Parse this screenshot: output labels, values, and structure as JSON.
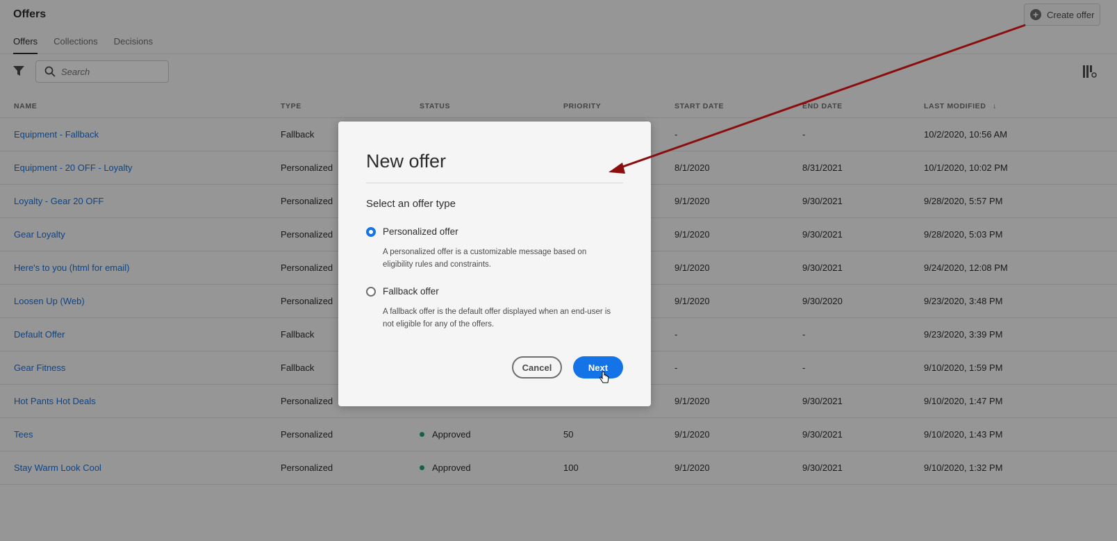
{
  "header": {
    "title": "Offers",
    "create_label": "Create offer",
    "tabs": [
      "Offers",
      "Collections",
      "Decisions"
    ]
  },
  "search": {
    "placeholder": "Search"
  },
  "table": {
    "columns": [
      "NAME",
      "TYPE",
      "STATUS",
      "PRIORITY",
      "START DATE",
      "END DATE",
      "LAST MODIFIED"
    ],
    "rows": [
      {
        "name": "Equipment - Fallback",
        "type": "Fallback",
        "status": "",
        "priority": "",
        "start": "-",
        "end": "-",
        "modified": "10/2/2020, 10:56 AM"
      },
      {
        "name": "Equipment - 20 OFF - Loyalty",
        "type": "Personalized",
        "status": "",
        "priority": "",
        "start": "8/1/2020",
        "end": "8/31/2021",
        "modified": "10/1/2020, 10:02 PM"
      },
      {
        "name": "Loyalty - Gear 20 OFF",
        "type": "Personalized",
        "status": "",
        "priority": "",
        "start": "9/1/2020",
        "end": "9/30/2021",
        "modified": "9/28/2020, 5:57 PM"
      },
      {
        "name": "Gear Loyalty",
        "type": "Personalized",
        "status": "",
        "priority": "",
        "start": "9/1/2020",
        "end": "9/30/2021",
        "modified": "9/28/2020, 5:03 PM"
      },
      {
        "name": "Here's to you (html for email)",
        "type": "Personalized",
        "status": "",
        "priority": "",
        "start": "9/1/2020",
        "end": "9/30/2021",
        "modified": "9/24/2020, 12:08 PM"
      },
      {
        "name": "Loosen Up (Web)",
        "type": "Personalized",
        "status": "",
        "priority": "",
        "start": "9/1/2020",
        "end": "9/30/2020",
        "modified": "9/23/2020, 3:48 PM"
      },
      {
        "name": "Default Offer",
        "type": "Fallback",
        "status": "",
        "priority": "",
        "start": "-",
        "end": "-",
        "modified": "9/23/2020, 3:39 PM"
      },
      {
        "name": "Gear Fitness",
        "type": "Fallback",
        "status": "",
        "priority": "",
        "start": "-",
        "end": "-",
        "modified": "9/10/2020, 1:59 PM"
      },
      {
        "name": "Hot Pants Hot Deals",
        "type": "Personalized",
        "status": "",
        "priority": "",
        "start": "9/1/2020",
        "end": "9/30/2021",
        "modified": "9/10/2020, 1:47 PM"
      },
      {
        "name": "Tees",
        "type": "Personalized",
        "status": "Approved",
        "priority": "50",
        "start": "9/1/2020",
        "end": "9/30/2021",
        "modified": "9/10/2020, 1:43 PM"
      },
      {
        "name": "Stay Warm Look Cool",
        "type": "Personalized",
        "status": "Approved",
        "priority": "100",
        "start": "9/1/2020",
        "end": "9/30/2021",
        "modified": "9/10/2020, 1:32 PM"
      }
    ]
  },
  "modal": {
    "title": "New offer",
    "subtitle": "Select an offer type",
    "options": [
      {
        "label": "Personalized offer",
        "description": "A personalized offer is a customizable message based on eligibility rules and constraints.",
        "selected": true
      },
      {
        "label": "Fallback offer",
        "description": "A fallback offer is the default offer displayed when an end-user is not eligible for any of the offers.",
        "selected": false
      }
    ],
    "cancel_label": "Cancel",
    "next_label": "Next"
  },
  "colors": {
    "accent": "#1473e6",
    "approved": "#2d9d78",
    "annotation_arrow": "#8b0d0d"
  },
  "icons": [
    "plus-circle-icon",
    "filter-icon",
    "search-icon",
    "column-settings-icon",
    "sort-down-icon",
    "hand-cursor-icon"
  ]
}
